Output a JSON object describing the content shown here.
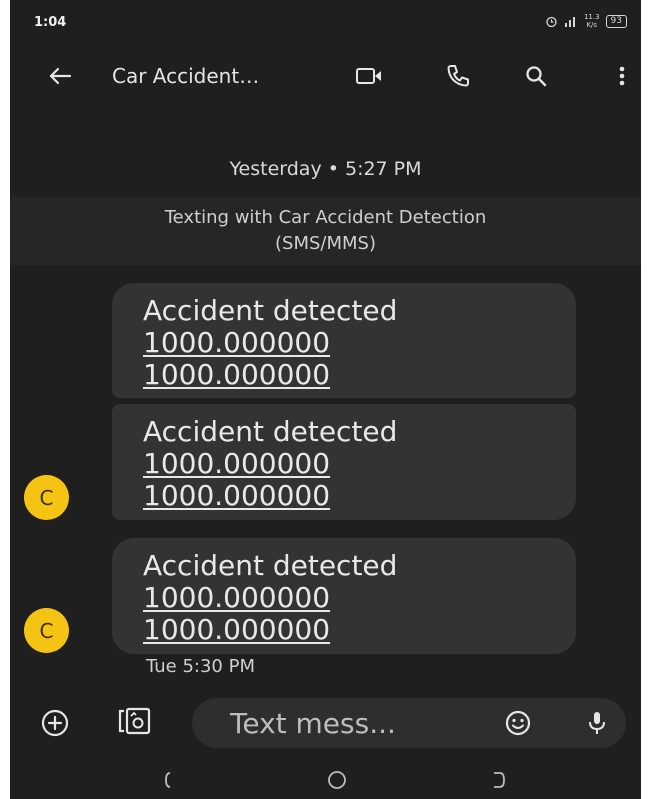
{
  "status_bar": {
    "time": "1:04",
    "speed_value": "11.3",
    "speed_unit": "K/s",
    "battery": "93"
  },
  "app_bar": {
    "title": "Car Accident…"
  },
  "conversation": {
    "date_header": "Yesterday • 5:27 PM",
    "banner_line1": "Texting with Car Accident Detection",
    "banner_line2": "(SMS/MMS)",
    "messages": [
      {
        "text": "Accident detected",
        "coord1": "1000.000000",
        "coord2": "1000.000000"
      },
      {
        "text": "Accident detected",
        "coord1": "1000.000000",
        "coord2": "1000.000000",
        "avatar": "C"
      },
      {
        "text": "Accident detected",
        "coord1": "1000.000000",
        "coord2": "1000.000000",
        "avatar": "C"
      }
    ],
    "last_timestamp": "Tue 5:30 PM"
  },
  "compose": {
    "placeholder": "Text mess..."
  },
  "colors": {
    "background": "#1f1f1f",
    "bubble": "#333333",
    "avatar": "#f5c314",
    "banner": "#262626"
  }
}
